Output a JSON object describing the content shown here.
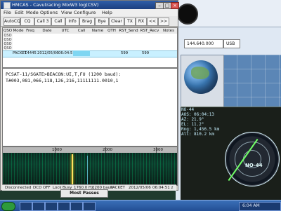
{
  "app": {
    "title": "HMCAS - Cavutracing MixW3 log(CSV)",
    "menus": [
      "File",
      "Edit",
      "Mode",
      "Options",
      "View",
      "Configure",
      "Help"
    ],
    "toolbar": [
      "AutoCQ",
      "CQ",
      "Call 3",
      "Call",
      "Info",
      "Brag",
      "Bye",
      "Clear",
      "TX",
      "RX",
      "<<",
      ">>"
    ]
  },
  "log": {
    "columns": [
      "QSO",
      "Mode",
      "Freq",
      "Date",
      "UTC",
      "Call",
      "Name",
      "QTH",
      "RST_Send",
      "RST_Recv",
      "Notes"
    ],
    "row_labels": [
      "QSO",
      "QSO",
      "QSO",
      "QSO"
    ],
    "selected": {
      "mode": "PACKET",
      "freq": "14445",
      "date": "2012/05/06",
      "utc": "06:04:51",
      "call": "",
      "rst_send": "599",
      "rst_recv": "599"
    }
  },
  "rx_text": {
    "line1": "PCSAT-11/SGATE>BEACON:UI,T,FU (1200 baud):",
    "line2": "T#003,081,066,118,126,216,11111111.0010,1"
  },
  "waterfall": {
    "ruler_labels": [
      "1000",
      "2000",
      "3000"
    ]
  },
  "status": {
    "items": [
      "Disconnected",
      "DCD",
      "OFF",
      "Lock",
      "Busy",
      "1760.0 Hz",
      "1200 baud",
      "PACKET",
      "2012/05/06",
      "06:04:51 z"
    ]
  },
  "popup": {
    "label": "Most Passes"
  },
  "right": {
    "freq": "144.640.000",
    "mode": "USB",
    "sat_info": [
      "NO-44",
      "AOS: 06:04:13",
      "AZ: 21.9°",
      "EL: 11.2°",
      "Rng: 1,456.5 km",
      "Alt: 810.2 km"
    ],
    "radar_label": "NO-44"
  },
  "taskbar": {
    "time": "6:04 AM"
  }
}
